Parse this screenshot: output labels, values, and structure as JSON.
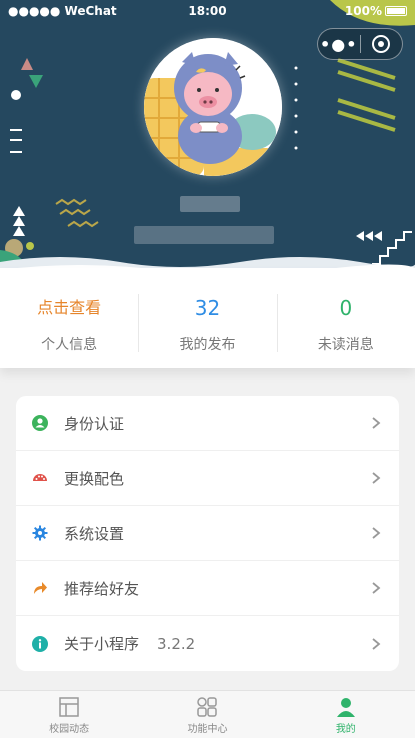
{
  "status_bar": {
    "carrier": "●●●●● WeChat",
    "time": "18:00",
    "battery": "100%"
  },
  "capsule": {
    "menu_glyph": "•●•"
  },
  "stats": [
    {
      "value": "点击查看",
      "label": "个人信息"
    },
    {
      "value": "32",
      "label": "我的发布"
    },
    {
      "value": "0",
      "label": "未读消息"
    }
  ],
  "menu": {
    "items": [
      {
        "label": "身份认证",
        "icon": "user-circle-icon",
        "color": "#3cb35c"
      },
      {
        "label": "更换配色",
        "icon": "palette-icon",
        "color": "#e0524a"
      },
      {
        "label": "系统设置",
        "icon": "gear-icon",
        "color": "#2a86e0"
      },
      {
        "label": "推荐给好友",
        "icon": "share-arrow-icon",
        "color": "#e88a2a"
      },
      {
        "label": "关于小程序",
        "icon": "info-icon",
        "color": "#1fb0a8",
        "value": "3.2.2"
      }
    ]
  },
  "tabbar": {
    "tabs": [
      {
        "label": "校园动态",
        "icon": "layout-icon"
      },
      {
        "label": "功能中心",
        "icon": "grid-icon"
      },
      {
        "label": "我的",
        "icon": "person-icon",
        "active": true
      }
    ]
  },
  "colors": {
    "header_bg": "#25485f",
    "accent_green": "#2fb36b",
    "accent_blue": "#2f8de4",
    "accent_orange": "#e6852b"
  }
}
